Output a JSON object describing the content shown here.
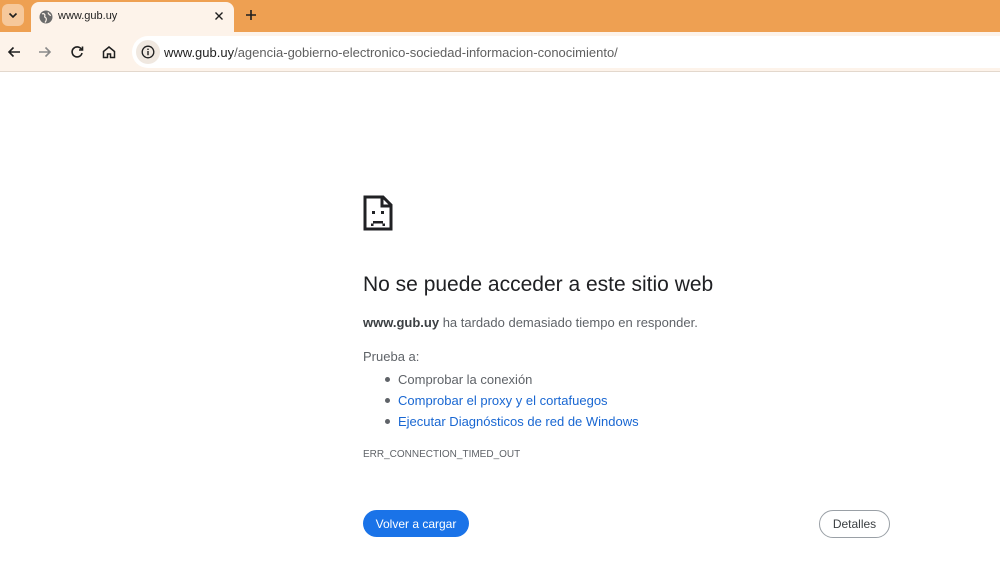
{
  "browser": {
    "tab": {
      "title": "www.gub.uy",
      "favicon": "globe-icon"
    },
    "toolbar": {
      "url_host": "www.gub.uy",
      "url_path": "/agencia-gobierno-electronico-sociedad-informacion-conocimiento/"
    },
    "icons": [
      "tab-search-icon",
      "globe-icon",
      "close-icon",
      "plus-icon",
      "back-arrow-icon",
      "forward-arrow-icon",
      "reload-icon",
      "home-icon",
      "site-info-icon"
    ],
    "colors": {
      "tabstrip": "#eea052",
      "toolbar": "#fdf3ea"
    }
  },
  "error": {
    "icon": "sad-page-icon",
    "title": "No se puede acceder a este sitio web",
    "host": "www.gub.uy",
    "description_rest": " ha tardado demasiado tiempo en responder.",
    "try_label": "Prueba a:",
    "suggestions": [
      "Comprobar la conexión",
      "Comprobar el proxy y el cortafuegos",
      "Ejecutar Diagnósticos de red de Windows"
    ],
    "code": "ERR_CONNECTION_TIMED_OUT",
    "reload_label": "Volver a cargar",
    "details_label": "Detalles",
    "colors": {
      "link": "#1967d2",
      "primary_button": "#1a73e8"
    }
  }
}
